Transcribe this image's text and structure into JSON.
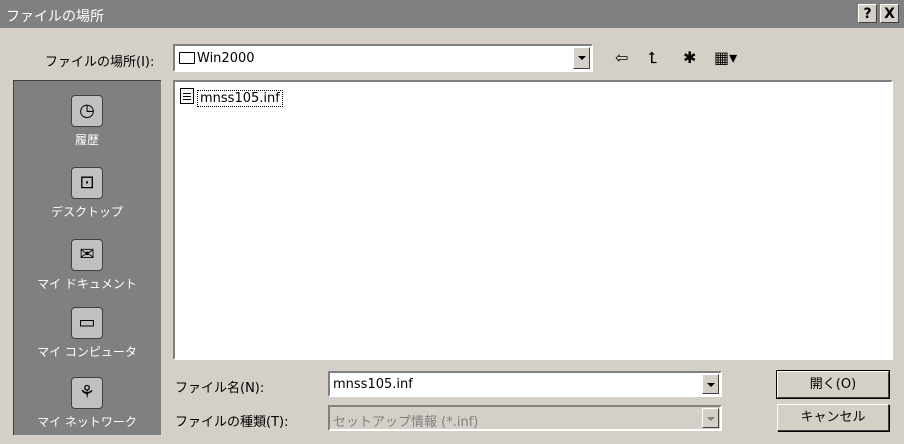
{
  "window": {
    "title": "ファイルの場所",
    "help_btn": "?",
    "close_btn": "X"
  },
  "toolbar": {
    "location_label": "ファイルの場所(I):",
    "location_value": "Win2000",
    "back_icon": "⇦",
    "up_icon": "⮤",
    "newfolder_icon": "✱",
    "view_icon": "▦▾"
  },
  "places": [
    {
      "label": "履歴",
      "icon": "history-icon",
      "glyph": "◷"
    },
    {
      "label": "デスクトップ",
      "icon": "desktop-icon",
      "glyph": "⊡"
    },
    {
      "label": "マイ ドキュメント",
      "icon": "my-documents-icon",
      "glyph": "✉"
    },
    {
      "label": "マイ コンピュータ",
      "icon": "my-computer-icon",
      "glyph": "▭"
    },
    {
      "label": "マイ ネットワーク",
      "icon": "my-network-icon",
      "glyph": "⚘"
    }
  ],
  "files": [
    {
      "name": "mnss105.inf",
      "icon": "inf-file-icon"
    }
  ],
  "filename": {
    "label": "ファイル名(N):",
    "value": "mnss105.inf"
  },
  "filetype": {
    "label": "ファイルの種類(T):",
    "value": "セットアップ情報 (*.inf)"
  },
  "buttons": {
    "open": "開く(O)",
    "cancel": "キャンセル"
  }
}
